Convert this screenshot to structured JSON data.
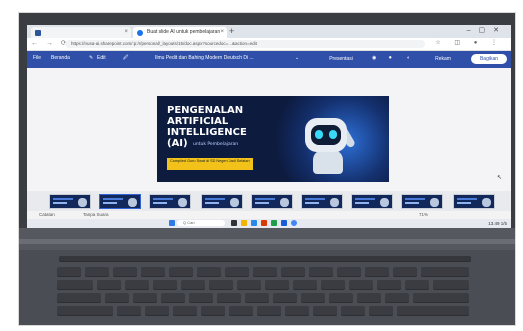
{
  "browser": {
    "tabs": [
      {
        "label": "",
        "active": false
      },
      {
        "label": "Buat slide AI untuk pembelajaran",
        "active": true
      }
    ],
    "new_tab": "+",
    "address": "https://nusa-ai.sharepoint.com/:p:/r/personal/_layouts/15/doc.aspx?sourcedoc=...&action=edit",
    "nav_icons": "← → ⟳"
  },
  "ppt": {
    "file": "File",
    "home": "Beranda",
    "edit": "Edit",
    "design": "",
    "doc_title": "Ilmu Pedit dan Bahing Modern Deutsch Di ...",
    "share_label": "Bagikan",
    "present_label": "Presentasi",
    "record_label": "Rekam",
    "accent": "#2f4fa8"
  },
  "slide": {
    "line1": "PENGENALAN",
    "line2": "ARTIFICIAL",
    "line3": "INTELLIGENCE",
    "line4": "(AI)",
    "tagline": "untuk Pembelajaran",
    "note": "Compiled Guru Swat di SD Negeri Jadi Selatan"
  },
  "status": {
    "notes": "Catatan",
    "mode": "Tanpa Suara",
    "zoom": "71%"
  },
  "taskbar": {
    "search": "Q  Cari",
    "time": "13.49",
    "date": "1/5"
  },
  "thumbnails_count": 9
}
